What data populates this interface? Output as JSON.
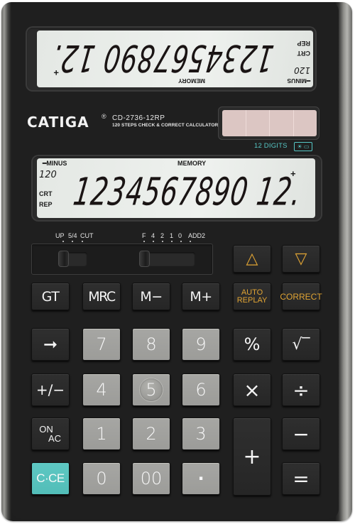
{
  "brand": {
    "name": "CATIGA",
    "registered": "®",
    "model": "CD-2736-12RP",
    "tagline": "120 STEPS CHECK & CORRECT CALCULATOR",
    "digits_label": "12 DIGITS",
    "digits_icon": "☀ ▭"
  },
  "display_top": {
    "orientation": "upside-down",
    "value": "1234567890 12.",
    "sign": "+",
    "indicators": {
      "minus": "━MINUS",
      "memory": "MEMORY",
      "step": "120",
      "crt": "CRT",
      "rep": "REP"
    }
  },
  "display_bottom": {
    "orientation": "normal",
    "value": "1234567890 12.",
    "sign": "+",
    "indicators": {
      "minus": "━MINUS",
      "memory": "MEMORY",
      "step": "120",
      "crt": "CRT",
      "rep": "REP"
    }
  },
  "switches": {
    "rounding": {
      "options": [
        "UP",
        "5/4",
        "CUT"
      ],
      "selected": "UP"
    },
    "decimal": {
      "options": [
        "F",
        "4",
        "2",
        "1",
        "0",
        "ADD2"
      ],
      "selected": "F"
    }
  },
  "keys": {
    "step_up": "△",
    "step_down": "▽",
    "gt": "GT",
    "mrc": "MRC",
    "m_minus": "M−",
    "m_plus": "M+",
    "auto_replay_1": "AUTO",
    "auto_replay_2": "REPLAY",
    "correct": "CORRECT",
    "arrow": "➞",
    "seven": "7",
    "eight": "8",
    "nine": "9",
    "percent": "%",
    "sqrt": "√‾",
    "plus_minus": "+∕−",
    "four": "4",
    "five": "5",
    "six": "6",
    "multiply": "×",
    "divide": "÷",
    "on_ac_1": "ON",
    "on_ac_2": "AC",
    "one": "1",
    "two": "2",
    "three": "3",
    "plus": "+",
    "minus": "−",
    "c_ce": "C·CE",
    "zero": "0",
    "double_zero": "00",
    "decimal_point": "·",
    "equals": "="
  },
  "colors": {
    "body": "#1f1f1f",
    "lcd": "#e6eae6",
    "numeric_key": "#a3a3a0",
    "function_key": "#2b2b2b",
    "accent_gold": "#e0a434",
    "accent_teal": "#56c7c5",
    "solar": "#dcc6c3"
  }
}
